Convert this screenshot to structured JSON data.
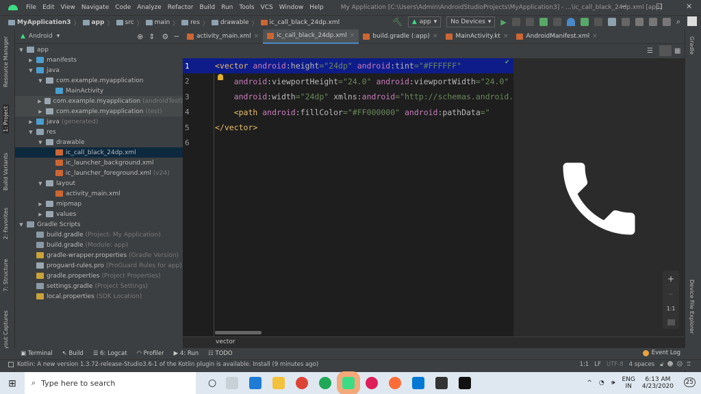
{
  "menu": {
    "items": [
      "File",
      "Edit",
      "View",
      "Navigate",
      "Code",
      "Analyze",
      "Refactor",
      "Build",
      "Run",
      "Tools",
      "VCS",
      "Window",
      "Help"
    ],
    "title": "My Application [C:\\Users\\Admin\\AndroidStudioProjects\\MyApplication3] - ...\\ic_call_black_24dp.xml [app]"
  },
  "breadcrumb": [
    "MyApplication3",
    "app",
    "src",
    "main",
    "res",
    "drawable",
    "ic_call_black_24dp.xml"
  ],
  "toolbar": {
    "config": "app",
    "device": "No Devices"
  },
  "project_panel": {
    "view": "Android"
  },
  "tree": [
    {
      "label": "app",
      "hint": "",
      "depth": 0,
      "arrow": "▼",
      "color": "#8ea2b0"
    },
    {
      "label": "manifests",
      "hint": "",
      "depth": 1,
      "arrow": "▶",
      "color": "#4a9fd0"
    },
    {
      "label": "java",
      "hint": "",
      "depth": 1,
      "arrow": "▼",
      "color": "#4a9fd0"
    },
    {
      "label": "com.example.myapplication",
      "hint": "",
      "depth": 2,
      "arrow": "▼",
      "color": "#9aa7b0"
    },
    {
      "label": "MainActivity",
      "hint": "",
      "depth": 3,
      "arrow": "",
      "color": "#4a9fd0"
    },
    {
      "label": "com.example.myapplication",
      "hint": "(androidTest)",
      "depth": 2,
      "arrow": "▶",
      "color": "#9aa7b0",
      "test": true
    },
    {
      "label": "com.example.myapplication",
      "hint": "(test)",
      "depth": 2,
      "arrow": "▶",
      "color": "#9aa7b0",
      "test": true
    },
    {
      "label": "java",
      "hint": "(generated)",
      "depth": 1,
      "arrow": "▶",
      "color": "#4a9fd0"
    },
    {
      "label": "res",
      "hint": "",
      "depth": 1,
      "arrow": "▼",
      "color": "#8ea2b0"
    },
    {
      "label": "drawable",
      "hint": "",
      "depth": 2,
      "arrow": "▼",
      "color": "#9aa7b0"
    },
    {
      "label": "ic_call_black_24dp.xml",
      "hint": "",
      "depth": 3,
      "arrow": "",
      "color": "#cc6633",
      "sel": true
    },
    {
      "label": "ic_launcher_background.xml",
      "hint": "",
      "depth": 3,
      "arrow": "",
      "color": "#cc6633"
    },
    {
      "label": "ic_launcher_foreground.xml",
      "hint": "(v24)",
      "depth": 3,
      "arrow": "",
      "color": "#cc6633"
    },
    {
      "label": "layout",
      "hint": "",
      "depth": 2,
      "arrow": "▼",
      "color": "#9aa7b0"
    },
    {
      "label": "activity_main.xml",
      "hint": "",
      "depth": 3,
      "arrow": "",
      "color": "#cc6633"
    },
    {
      "label": "mipmap",
      "hint": "",
      "depth": 2,
      "arrow": "▶",
      "color": "#9aa7b0"
    },
    {
      "label": "values",
      "hint": "",
      "depth": 2,
      "arrow": "▶",
      "color": "#9aa7b0"
    },
    {
      "label": "Gradle Scripts",
      "hint": "",
      "depth": 0,
      "arrow": "▼",
      "color": "#8a9aa6"
    },
    {
      "label": "build.gradle",
      "hint": "(Project: My Application)",
      "depth": 1,
      "arrow": "",
      "color": "#8a9aa6"
    },
    {
      "label": "build.gradle",
      "hint": "(Module: app)",
      "depth": 1,
      "arrow": "",
      "color": "#8a9aa6"
    },
    {
      "label": "gradle-wrapper.properties",
      "hint": "(Gradle Version)",
      "depth": 1,
      "arrow": "",
      "color": "#c9a23a"
    },
    {
      "label": "proguard-rules.pro",
      "hint": "(ProGuard Rules for app)",
      "depth": 1,
      "arrow": "",
      "color": "#9aa7b0"
    },
    {
      "label": "gradle.properties",
      "hint": "(Project Properties)",
      "depth": 1,
      "arrow": "",
      "color": "#c9a23a"
    },
    {
      "label": "settings.gradle",
      "hint": "(Project Settings)",
      "depth": 1,
      "arrow": "",
      "color": "#8a9aa6"
    },
    {
      "label": "local.properties",
      "hint": "(SDK Location)",
      "depth": 1,
      "arrow": "",
      "color": "#c9a23a"
    }
  ],
  "tabs": [
    {
      "label": "activity_main.xml",
      "active": false
    },
    {
      "label": "ic_call_black_24dp.xml",
      "active": true
    },
    {
      "label": "build.gradle (:app)",
      "active": false
    },
    {
      "label": "MainActivity.kt",
      "active": false
    },
    {
      "label": "AndroidManifest.xml",
      "active": false
    }
  ],
  "code": [
    [
      [
        "tg",
        "<vector "
      ],
      [
        "at",
        "android"
      ],
      [
        "an",
        ":height"
      ],
      [
        "eq",
        "="
      ],
      [
        "av",
        "\"24dp\" "
      ],
      [
        "at",
        "android"
      ],
      [
        "an",
        ":tint"
      ],
      [
        "eq",
        "="
      ],
      [
        "av",
        "\"#FFFFFF\""
      ]
    ],
    [
      [
        "at",
        "    android"
      ],
      [
        "an",
        ":viewportHeight"
      ],
      [
        "eq",
        "="
      ],
      [
        "av",
        "\"24.0\" "
      ],
      [
        "at",
        "android"
      ],
      [
        "an",
        ":viewportWidth"
      ],
      [
        "eq",
        "="
      ],
      [
        "av",
        "\"24.0\""
      ]
    ],
    [
      [
        "at",
        "    android"
      ],
      [
        "an",
        ":width"
      ],
      [
        "eq",
        "="
      ],
      [
        "av",
        "\"24dp\" "
      ],
      [
        "an",
        "xmlns:"
      ],
      [
        "at",
        "android"
      ],
      [
        "eq",
        "="
      ],
      [
        "av",
        "\"http://schemas.android.com/apk/res/android\">"
      ]
    ],
    [
      [
        "tg",
        "    <path "
      ],
      [
        "at",
        "android"
      ],
      [
        "an",
        ":fillColor"
      ],
      [
        "eq",
        "="
      ],
      [
        "av",
        "\"#FF000000\" "
      ],
      [
        "at",
        "android"
      ],
      [
        "an",
        ":pathData"
      ],
      [
        "eq",
        "="
      ],
      [
        "av",
        "\""
      ]
    ],
    [
      [
        "tg",
        "</vector>"
      ]
    ],
    []
  ],
  "editor_breadcrumb": "vector",
  "left_strip": [
    "Resource Manager",
    "1: Project",
    "Build Variants",
    "2: Favorites",
    "7: Structure",
    "Layout Captures"
  ],
  "right_strip": [
    "Gradle",
    "Device File Explorer"
  ],
  "preview": {
    "zoom_in": "+",
    "zoom_out": "−",
    "actual_size": "1:1"
  },
  "bottom_tools": [
    "Terminal",
    "Build",
    "6: Logcat",
    "Profiler",
    "4: Run",
    "TODO"
  ],
  "event_log": "Event Log",
  "status": {
    "message": "Kotlin: A new version 1.3.72-release-Studio3.6-1 of the Kotlin plugin is available. Install (9 minutes ago)",
    "position": "1:1",
    "line_sep": "LF",
    "encoding": "UTF-8",
    "indent": "4 spaces"
  },
  "taskbar": {
    "search_placeholder": "Type here to search",
    "lang": "ENG",
    "region": "IN",
    "time": "6:13 AM",
    "date": "4/23/2020",
    "notifications": "25"
  }
}
